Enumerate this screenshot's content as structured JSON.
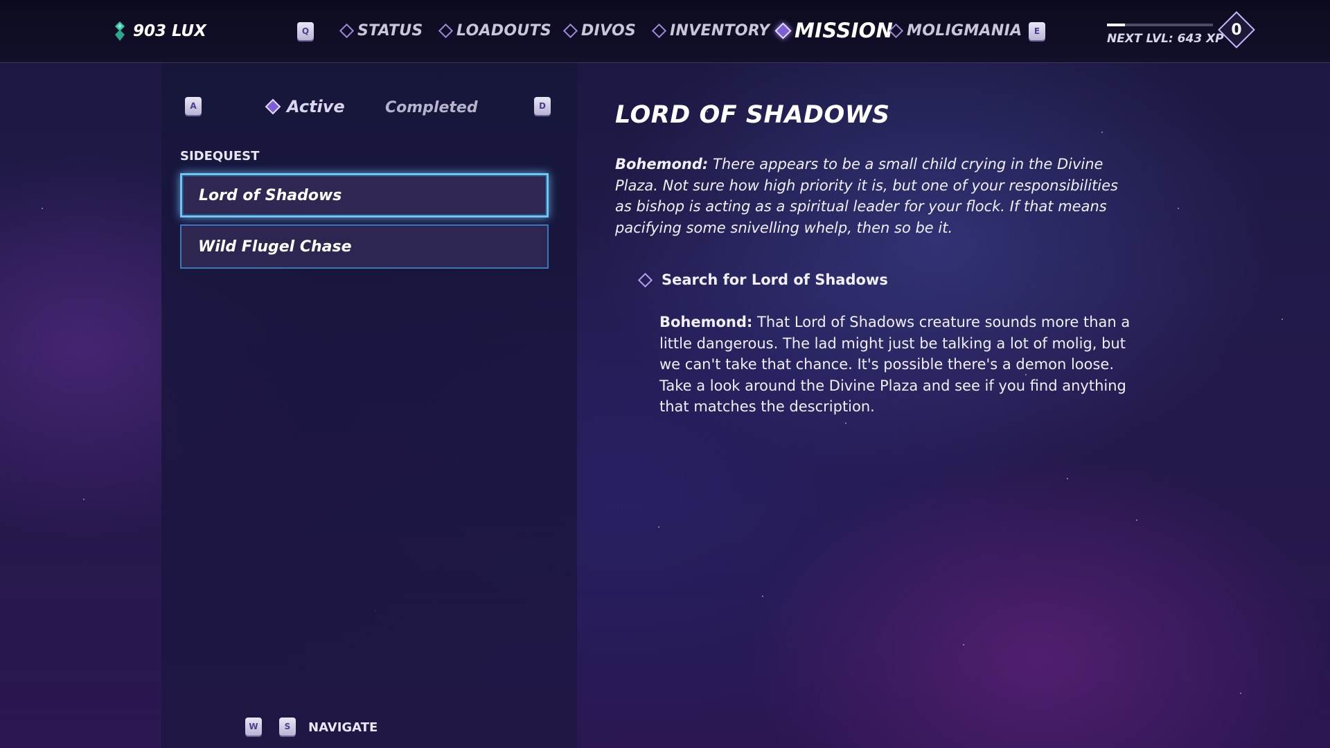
{
  "header": {
    "currency": "903 LUX",
    "prev_key": "Q",
    "next_key": "E",
    "tabs": [
      {
        "label": "STATUS"
      },
      {
        "label": "LOADOUTS"
      },
      {
        "label": "DIVOS"
      },
      {
        "label": "INVENTORY"
      },
      {
        "label": "MISSION"
      },
      {
        "label": "MOLIGMANIA"
      }
    ],
    "active_tab": "MISSION",
    "xp_text": "NEXT LVL: 643 XP",
    "xp_progress_fraction": 0.17,
    "level": "0"
  },
  "mission_list": {
    "left_key": "A",
    "right_key": "D",
    "filter_active": "Active",
    "filter_completed": "Completed",
    "section_title": "SIDEQUEST",
    "quests": [
      {
        "name": "Lord of Shadows"
      },
      {
        "name": "Wild Flugel Chase"
      }
    ],
    "navigate_keys": [
      "W",
      "S"
    ],
    "navigate_label": "NAVIGATE"
  },
  "detail": {
    "title": "LORD OF SHADOWS",
    "intro_speaker": "Bohemond:",
    "intro_text": " There appears to be a small child crying in the Divine Plaza. Not sure how high priority it is, but one of your responsibilities as bishop is acting as a spiritual leader for your flock. If that means pacifying some snivelling whelp, then so be it.",
    "objective": "Search for Lord of Shadows",
    "objective_speaker": "Bohemond:",
    "objective_text": " That Lord of Shadows creature sounds more than a little dangerous. The lad might just be talking a lot of molig, but we can't take that chance. It's possible there's a demon loose. Take a look around the Divine Plaza and see if you find anything that matches the description."
  },
  "colors": {
    "accent": "#7c5fd6",
    "selection_glow": "#6fc6f4",
    "currency_icon": "#38c7a8"
  }
}
